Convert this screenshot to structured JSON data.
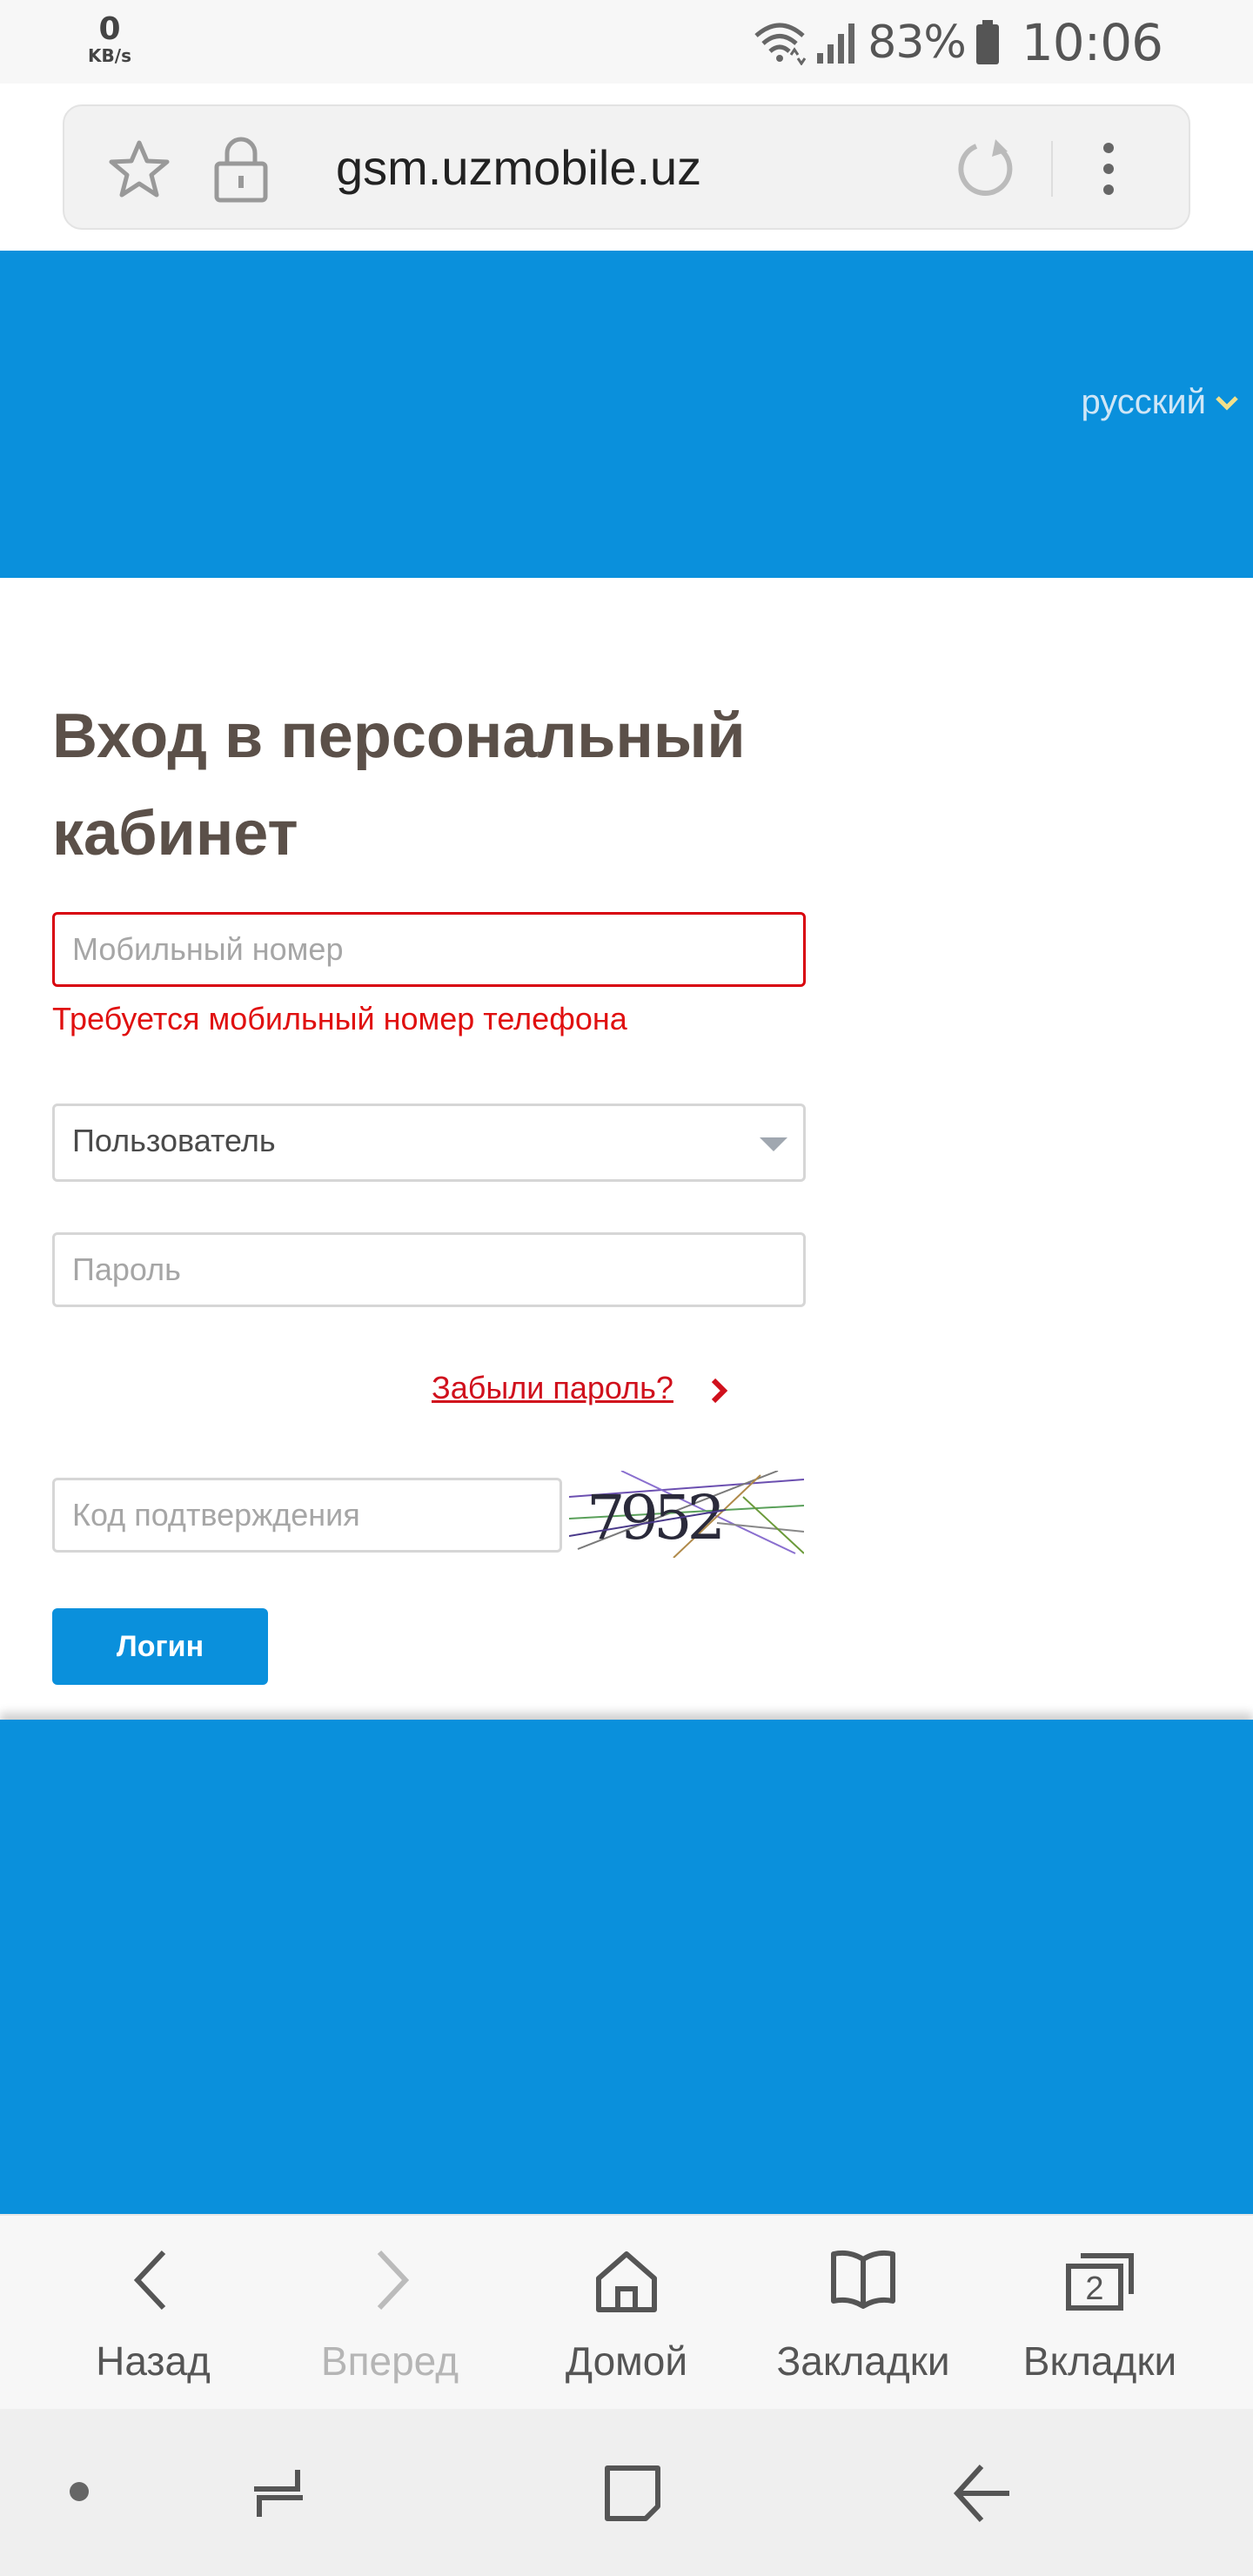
{
  "status_bar": {
    "net_speed_value": "0",
    "net_speed_unit": "KB/s",
    "battery_percent": "83%",
    "time": "10:06"
  },
  "address_bar": {
    "url": "gsm.uzmobile.uz"
  },
  "header": {
    "language": "русский"
  },
  "login": {
    "title": "Вход в персональный кабинет",
    "phone_placeholder": "Мобильный номер",
    "phone_error": "Требуется мобильный номер телефона",
    "role_selected": "Пользователь",
    "password_placeholder": "Пароль",
    "forgot_password": "Забыли пароль?",
    "captcha_placeholder": "Код подтверждения",
    "captcha_text": "7952",
    "login_button": "Логин"
  },
  "toolbar": {
    "back": "Назад",
    "forward": "Вперед",
    "home": "Домой",
    "bookmarks": "Закладки",
    "tabs": "Вкладки",
    "tabs_count": "2"
  },
  "colors": {
    "brand_blue": "#0a90dc",
    "error_red": "#d8000c",
    "title_brown": "#5b5049"
  }
}
